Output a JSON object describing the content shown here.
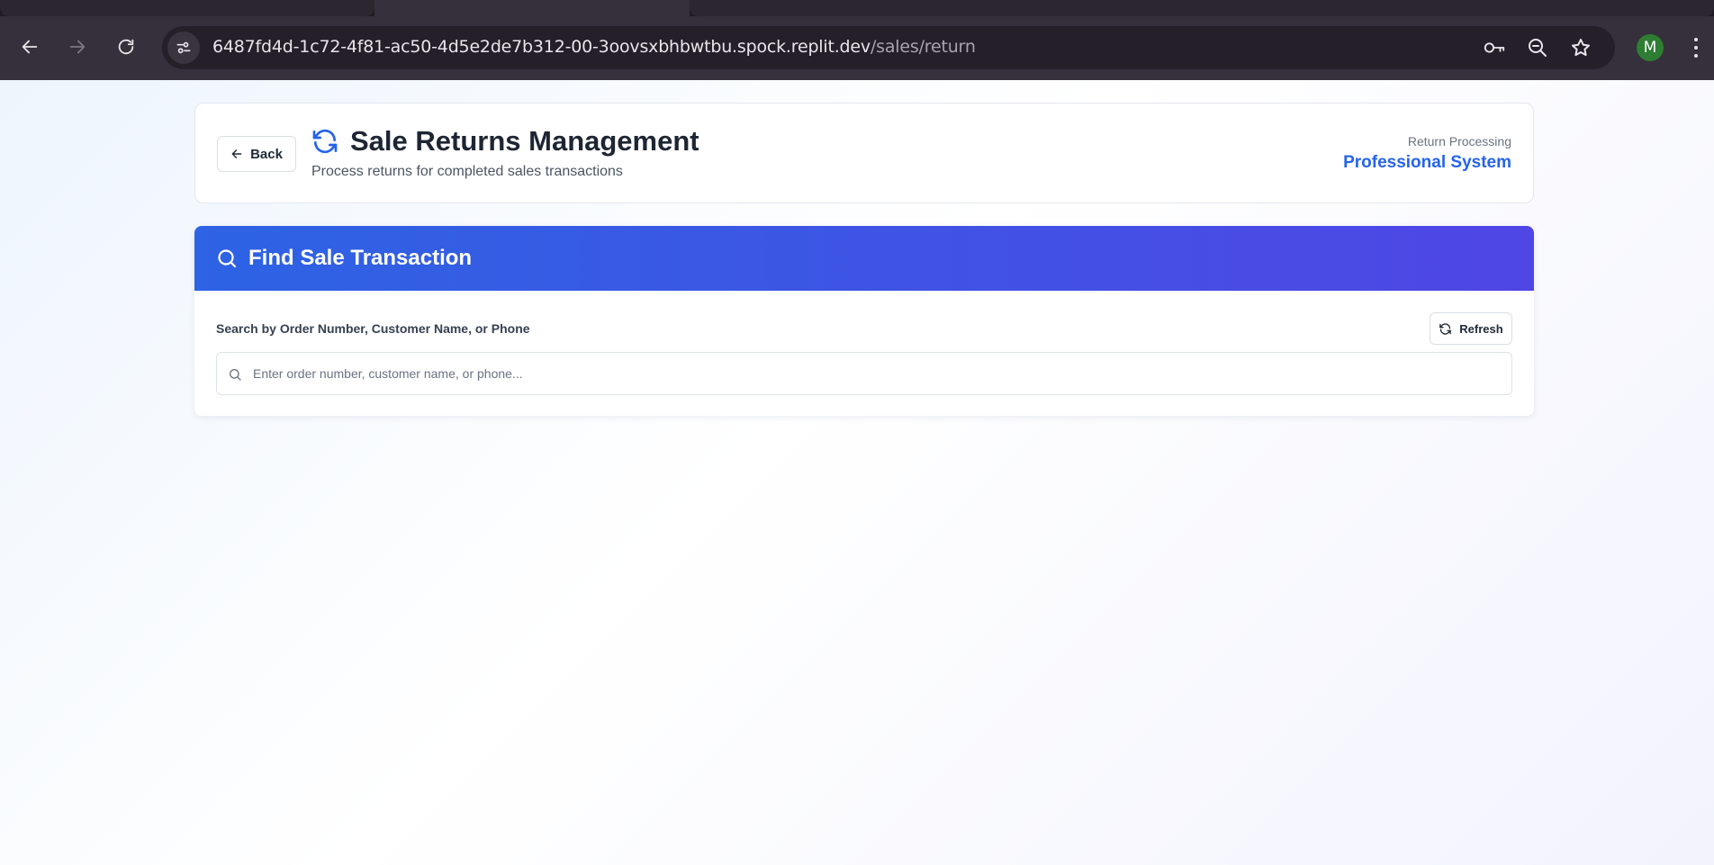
{
  "browser": {
    "url_host": "6487fd4d-1c72-4f81-ac50-4d5e2de7b312-00-3oovsxbhbwtbu.spock.replit.dev",
    "url_path": "/sales/return",
    "profile_initial": "M",
    "icons": [
      "back-icon",
      "forward-icon",
      "reload-icon",
      "site-settings-icon",
      "key-icon",
      "zoom-out-icon",
      "star-icon",
      "more-menu-icon"
    ]
  },
  "header": {
    "back_label": "Back",
    "title": "Sale Returns Management",
    "subtitle": "Process returns for completed sales transactions",
    "right_label": "Return Processing",
    "right_value": "Professional System"
  },
  "search": {
    "heading": "Find Sale Transaction",
    "label": "Search by Order Number, Customer Name, or Phone",
    "refresh_label": "Refresh",
    "placeholder": "Enter order number, customer name, or phone...",
    "value": ""
  },
  "colors": {
    "accent": "#2563eb",
    "header_gradient_start": "#2d63e4",
    "header_gradient_end": "#4f46e5",
    "avatar": "#2e7d32"
  }
}
